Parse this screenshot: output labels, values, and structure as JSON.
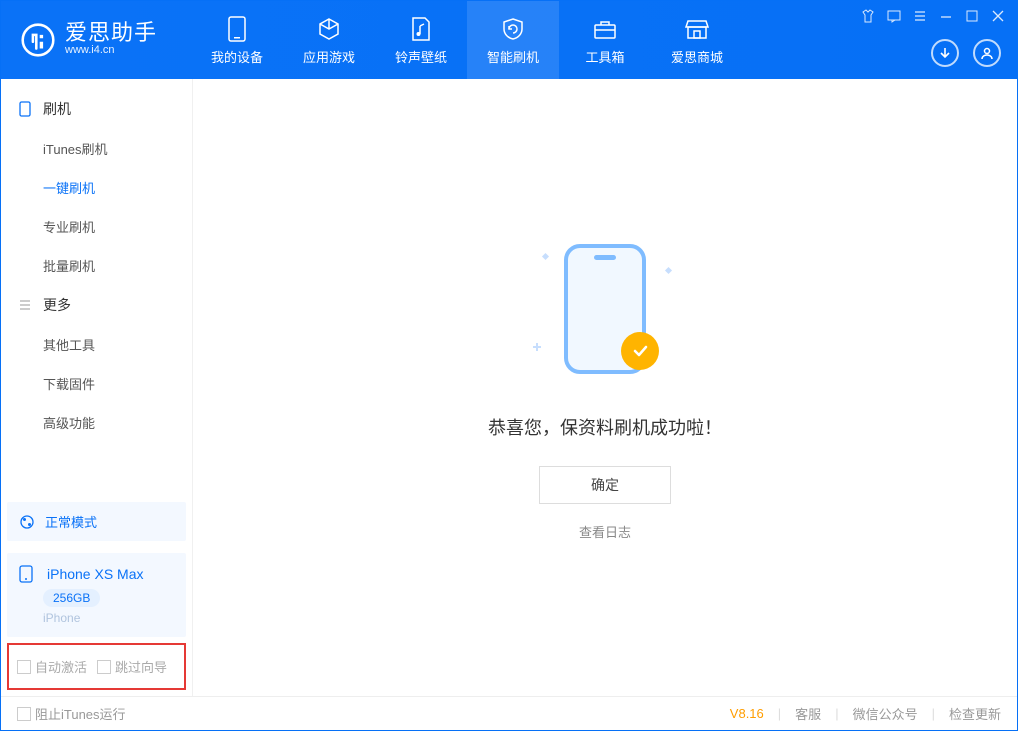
{
  "app": {
    "name": "爱思助手",
    "url": "www.i4.cn"
  },
  "nav": {
    "items": [
      {
        "label": "我的设备"
      },
      {
        "label": "应用游戏"
      },
      {
        "label": "铃声壁纸"
      },
      {
        "label": "智能刷机"
      },
      {
        "label": "工具箱"
      },
      {
        "label": "爱思商城"
      }
    ]
  },
  "sidebar": {
    "group1_title": "刷机",
    "group1_items": [
      {
        "label": "iTunes刷机"
      },
      {
        "label": "一键刷机"
      },
      {
        "label": "专业刷机"
      },
      {
        "label": "批量刷机"
      }
    ],
    "group2_title": "更多",
    "group2_items": [
      {
        "label": "其他工具"
      },
      {
        "label": "下载固件"
      },
      {
        "label": "高级功能"
      }
    ],
    "mode_panel": "正常模式",
    "device_name": "iPhone XS Max",
    "device_capacity": "256GB",
    "device_type": "iPhone",
    "checkbox1": "自动激活",
    "checkbox2": "跳过向导"
  },
  "main": {
    "success_text": "恭喜您，保资料刷机成功啦！",
    "ok_button": "确定",
    "view_log": "查看日志"
  },
  "footer": {
    "block_itunes": "阻止iTunes运行",
    "version": "V8.16",
    "links": [
      "客服",
      "微信公众号",
      "检查更新"
    ]
  }
}
